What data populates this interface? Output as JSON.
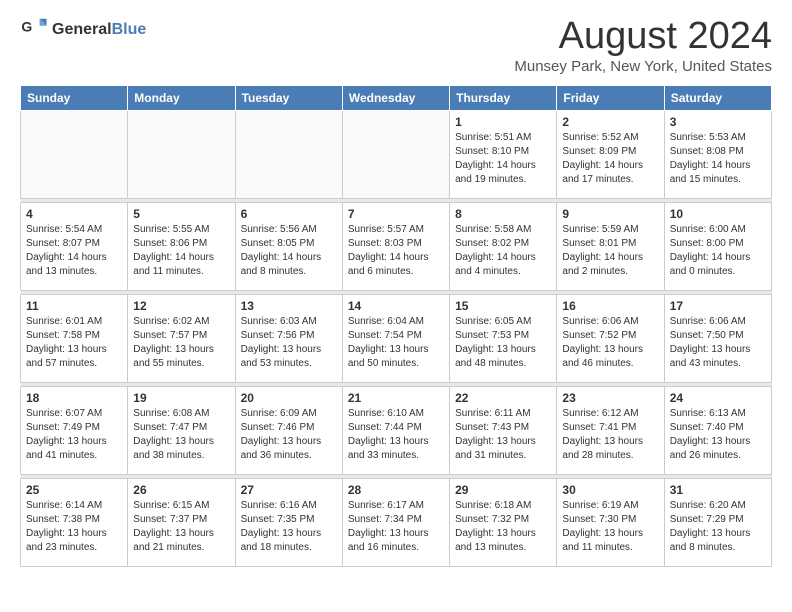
{
  "header": {
    "logo": {
      "general": "General",
      "blue": "Blue"
    },
    "title": "August 2024",
    "location": "Munsey Park, New York, United States"
  },
  "days_of_week": [
    "Sunday",
    "Monday",
    "Tuesday",
    "Wednesday",
    "Thursday",
    "Friday",
    "Saturday"
  ],
  "weeks": [
    [
      {
        "day": "",
        "detail": ""
      },
      {
        "day": "",
        "detail": ""
      },
      {
        "day": "",
        "detail": ""
      },
      {
        "day": "",
        "detail": ""
      },
      {
        "day": "1",
        "detail": "Sunrise: 5:51 AM\nSunset: 8:10 PM\nDaylight: 14 hours\nand 19 minutes."
      },
      {
        "day": "2",
        "detail": "Sunrise: 5:52 AM\nSunset: 8:09 PM\nDaylight: 14 hours\nand 17 minutes."
      },
      {
        "day": "3",
        "detail": "Sunrise: 5:53 AM\nSunset: 8:08 PM\nDaylight: 14 hours\nand 15 minutes."
      }
    ],
    [
      {
        "day": "4",
        "detail": "Sunrise: 5:54 AM\nSunset: 8:07 PM\nDaylight: 14 hours\nand 13 minutes."
      },
      {
        "day": "5",
        "detail": "Sunrise: 5:55 AM\nSunset: 8:06 PM\nDaylight: 14 hours\nand 11 minutes."
      },
      {
        "day": "6",
        "detail": "Sunrise: 5:56 AM\nSunset: 8:05 PM\nDaylight: 14 hours\nand 8 minutes."
      },
      {
        "day": "7",
        "detail": "Sunrise: 5:57 AM\nSunset: 8:03 PM\nDaylight: 14 hours\nand 6 minutes."
      },
      {
        "day": "8",
        "detail": "Sunrise: 5:58 AM\nSunset: 8:02 PM\nDaylight: 14 hours\nand 4 minutes."
      },
      {
        "day": "9",
        "detail": "Sunrise: 5:59 AM\nSunset: 8:01 PM\nDaylight: 14 hours\nand 2 minutes."
      },
      {
        "day": "10",
        "detail": "Sunrise: 6:00 AM\nSunset: 8:00 PM\nDaylight: 14 hours\nand 0 minutes."
      }
    ],
    [
      {
        "day": "11",
        "detail": "Sunrise: 6:01 AM\nSunset: 7:58 PM\nDaylight: 13 hours\nand 57 minutes."
      },
      {
        "day": "12",
        "detail": "Sunrise: 6:02 AM\nSunset: 7:57 PM\nDaylight: 13 hours\nand 55 minutes."
      },
      {
        "day": "13",
        "detail": "Sunrise: 6:03 AM\nSunset: 7:56 PM\nDaylight: 13 hours\nand 53 minutes."
      },
      {
        "day": "14",
        "detail": "Sunrise: 6:04 AM\nSunset: 7:54 PM\nDaylight: 13 hours\nand 50 minutes."
      },
      {
        "day": "15",
        "detail": "Sunrise: 6:05 AM\nSunset: 7:53 PM\nDaylight: 13 hours\nand 48 minutes."
      },
      {
        "day": "16",
        "detail": "Sunrise: 6:06 AM\nSunset: 7:52 PM\nDaylight: 13 hours\nand 46 minutes."
      },
      {
        "day": "17",
        "detail": "Sunrise: 6:06 AM\nSunset: 7:50 PM\nDaylight: 13 hours\nand 43 minutes."
      }
    ],
    [
      {
        "day": "18",
        "detail": "Sunrise: 6:07 AM\nSunset: 7:49 PM\nDaylight: 13 hours\nand 41 minutes."
      },
      {
        "day": "19",
        "detail": "Sunrise: 6:08 AM\nSunset: 7:47 PM\nDaylight: 13 hours\nand 38 minutes."
      },
      {
        "day": "20",
        "detail": "Sunrise: 6:09 AM\nSunset: 7:46 PM\nDaylight: 13 hours\nand 36 minutes."
      },
      {
        "day": "21",
        "detail": "Sunrise: 6:10 AM\nSunset: 7:44 PM\nDaylight: 13 hours\nand 33 minutes."
      },
      {
        "day": "22",
        "detail": "Sunrise: 6:11 AM\nSunset: 7:43 PM\nDaylight: 13 hours\nand 31 minutes."
      },
      {
        "day": "23",
        "detail": "Sunrise: 6:12 AM\nSunset: 7:41 PM\nDaylight: 13 hours\nand 28 minutes."
      },
      {
        "day": "24",
        "detail": "Sunrise: 6:13 AM\nSunset: 7:40 PM\nDaylight: 13 hours\nand 26 minutes."
      }
    ],
    [
      {
        "day": "25",
        "detail": "Sunrise: 6:14 AM\nSunset: 7:38 PM\nDaylight: 13 hours\nand 23 minutes."
      },
      {
        "day": "26",
        "detail": "Sunrise: 6:15 AM\nSunset: 7:37 PM\nDaylight: 13 hours\nand 21 minutes."
      },
      {
        "day": "27",
        "detail": "Sunrise: 6:16 AM\nSunset: 7:35 PM\nDaylight: 13 hours\nand 18 minutes."
      },
      {
        "day": "28",
        "detail": "Sunrise: 6:17 AM\nSunset: 7:34 PM\nDaylight: 13 hours\nand 16 minutes."
      },
      {
        "day": "29",
        "detail": "Sunrise: 6:18 AM\nSunset: 7:32 PM\nDaylight: 13 hours\nand 13 minutes."
      },
      {
        "day": "30",
        "detail": "Sunrise: 6:19 AM\nSunset: 7:30 PM\nDaylight: 13 hours\nand 11 minutes."
      },
      {
        "day": "31",
        "detail": "Sunrise: 6:20 AM\nSunset: 7:29 PM\nDaylight: 13 hours\nand 8 minutes."
      }
    ]
  ]
}
